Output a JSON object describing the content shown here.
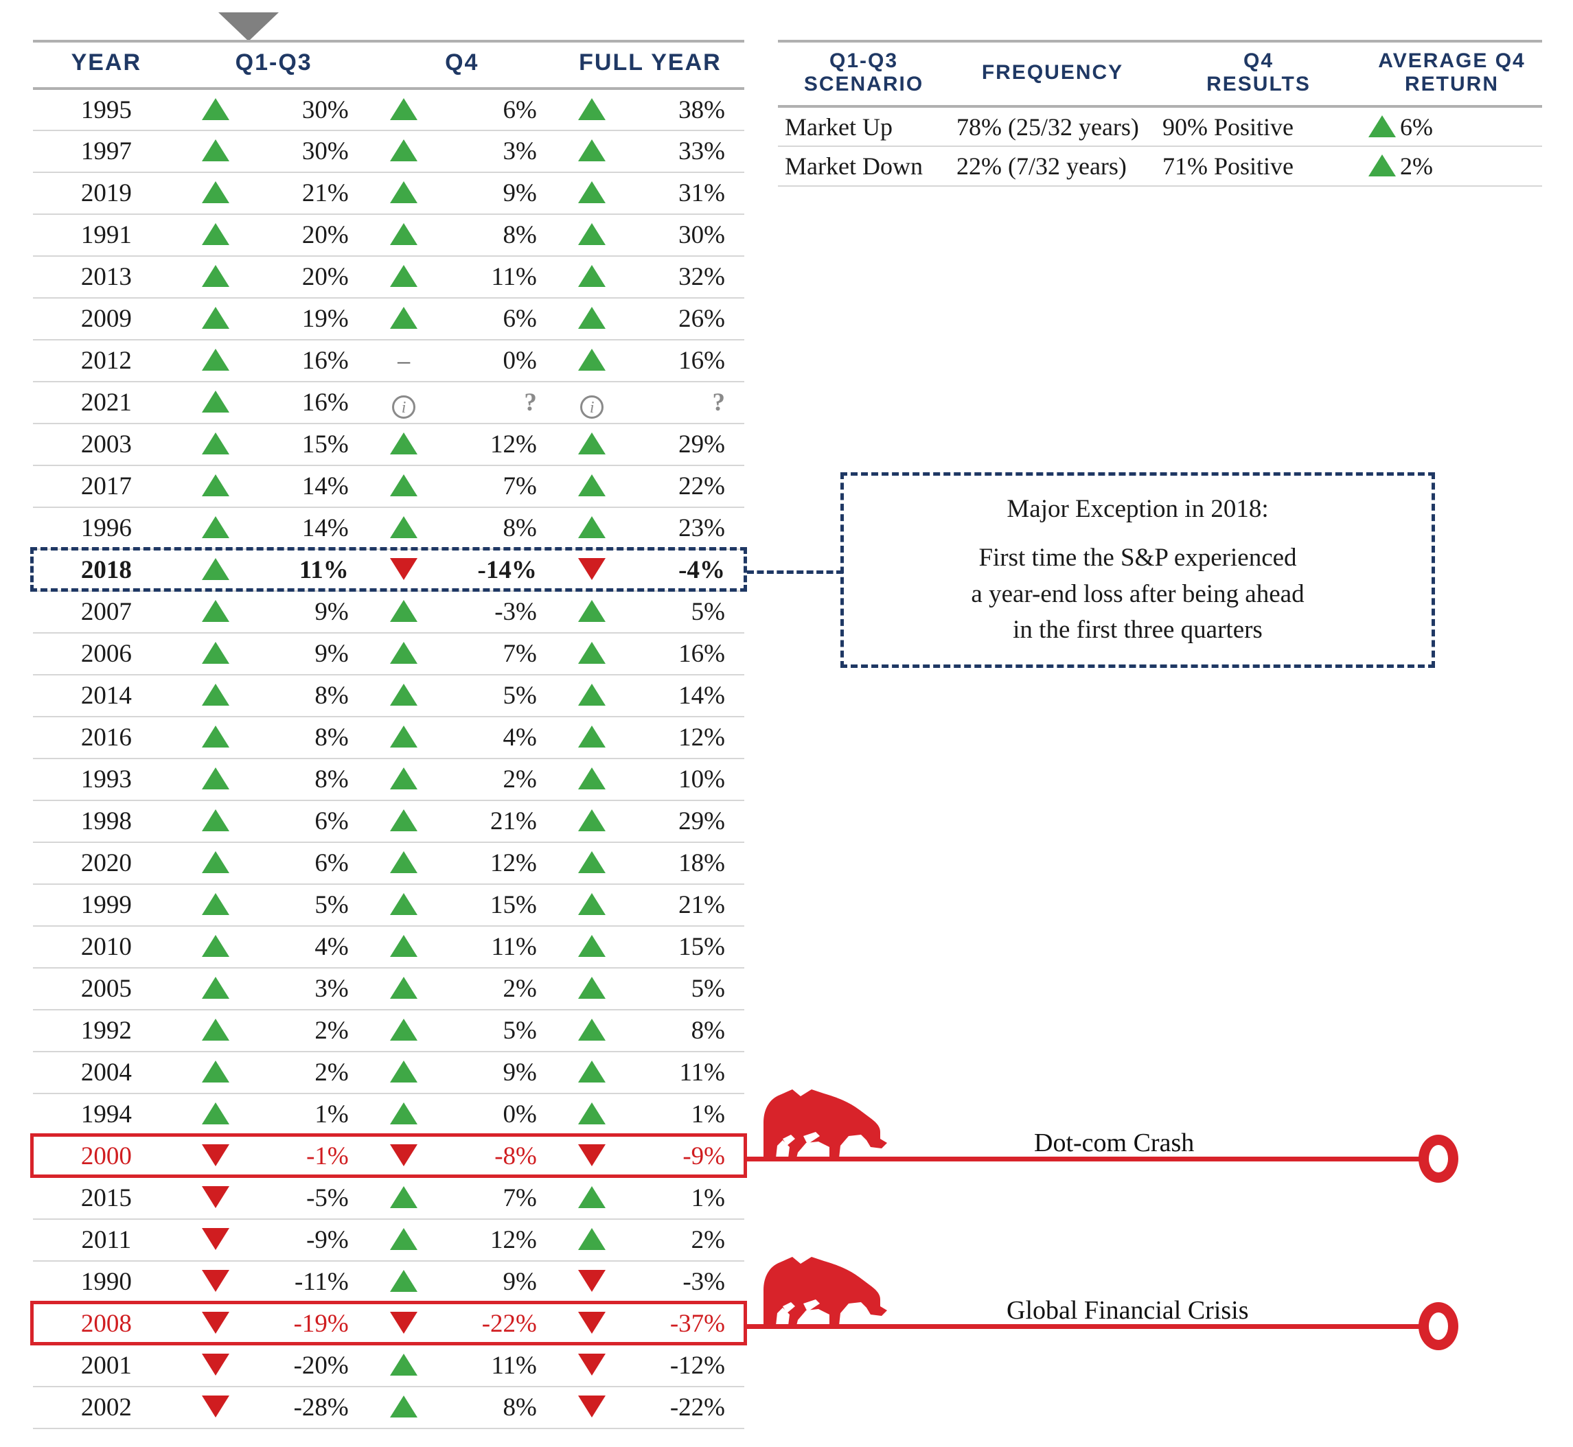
{
  "main_table": {
    "headers": [
      "YEAR",
      "Q1-Q3",
      "Q4",
      "FULL YEAR"
    ],
    "rows": [
      {
        "year": "1995",
        "q13_dir": "up",
        "q13": "30%",
        "q4_dir": "up",
        "q4": "6%",
        "fy_dir": "up",
        "fy": "38%",
        "style": "normal"
      },
      {
        "year": "1997",
        "q13_dir": "up",
        "q13": "30%",
        "q4_dir": "up",
        "q4": "3%",
        "fy_dir": "up",
        "fy": "33%",
        "style": "normal"
      },
      {
        "year": "2019",
        "q13_dir": "up",
        "q13": "21%",
        "q4_dir": "up",
        "q4": "9%",
        "fy_dir": "up",
        "fy": "31%",
        "style": "normal"
      },
      {
        "year": "1991",
        "q13_dir": "up",
        "q13": "20%",
        "q4_dir": "up",
        "q4": "8%",
        "fy_dir": "up",
        "fy": "30%",
        "style": "normal"
      },
      {
        "year": "2013",
        "q13_dir": "up",
        "q13": "20%",
        "q4_dir": "up",
        "q4": "11%",
        "fy_dir": "up",
        "fy": "32%",
        "style": "normal"
      },
      {
        "year": "2009",
        "q13_dir": "up",
        "q13": "19%",
        "q4_dir": "up",
        "q4": "6%",
        "fy_dir": "up",
        "fy": "26%",
        "style": "normal"
      },
      {
        "year": "2012",
        "q13_dir": "up",
        "q13": "16%",
        "q4_dir": "dash",
        "q4": "0%",
        "fy_dir": "up",
        "fy": "16%",
        "style": "normal"
      },
      {
        "year": "2021",
        "q13_dir": "up",
        "q13": "16%",
        "q4_dir": "info",
        "q4": "?",
        "fy_dir": "info",
        "fy": "?",
        "style": "normal"
      },
      {
        "year": "2003",
        "q13_dir": "up",
        "q13": "15%",
        "q4_dir": "up",
        "q4": "12%",
        "fy_dir": "up",
        "fy": "29%",
        "style": "normal"
      },
      {
        "year": "2017",
        "q13_dir": "up",
        "q13": "14%",
        "q4_dir": "up",
        "q4": "7%",
        "fy_dir": "up",
        "fy": "22%",
        "style": "normal"
      },
      {
        "year": "1996",
        "q13_dir": "up",
        "q13": "14%",
        "q4_dir": "up",
        "q4": "8%",
        "fy_dir": "up",
        "fy": "23%",
        "style": "normal"
      },
      {
        "year": "2018",
        "q13_dir": "up",
        "q13": "11%",
        "q4_dir": "down",
        "q4": "-14%",
        "fy_dir": "down",
        "fy": "-4%",
        "style": "bold"
      },
      {
        "year": "2007",
        "q13_dir": "up",
        "q13": "9%",
        "q4_dir": "up",
        "q4": "-3%",
        "fy_dir": "up",
        "fy": "5%",
        "style": "normal"
      },
      {
        "year": "2006",
        "q13_dir": "up",
        "q13": "9%",
        "q4_dir": "up",
        "q4": "7%",
        "fy_dir": "up",
        "fy": "16%",
        "style": "normal"
      },
      {
        "year": "2014",
        "q13_dir": "up",
        "q13": "8%",
        "q4_dir": "up",
        "q4": "5%",
        "fy_dir": "up",
        "fy": "14%",
        "style": "normal"
      },
      {
        "year": "2016",
        "q13_dir": "up",
        "q13": "8%",
        "q4_dir": "up",
        "q4": "4%",
        "fy_dir": "up",
        "fy": "12%",
        "style": "normal"
      },
      {
        "year": "1993",
        "q13_dir": "up",
        "q13": "8%",
        "q4_dir": "up",
        "q4": "2%",
        "fy_dir": "up",
        "fy": "10%",
        "style": "normal"
      },
      {
        "year": "1998",
        "q13_dir": "up",
        "q13": "6%",
        "q4_dir": "up",
        "q4": "21%",
        "fy_dir": "up",
        "fy": "29%",
        "style": "normal"
      },
      {
        "year": "2020",
        "q13_dir": "up",
        "q13": "6%",
        "q4_dir": "up",
        "q4": "12%",
        "fy_dir": "up",
        "fy": "18%",
        "style": "normal"
      },
      {
        "year": "1999",
        "q13_dir": "up",
        "q13": "5%",
        "q4_dir": "up",
        "q4": "15%",
        "fy_dir": "up",
        "fy": "21%",
        "style": "normal"
      },
      {
        "year": "2010",
        "q13_dir": "up",
        "q13": "4%",
        "q4_dir": "up",
        "q4": "11%",
        "fy_dir": "up",
        "fy": "15%",
        "style": "normal"
      },
      {
        "year": "2005",
        "q13_dir": "up",
        "q13": "3%",
        "q4_dir": "up",
        "q4": "2%",
        "fy_dir": "up",
        "fy": "5%",
        "style": "normal"
      },
      {
        "year": "1992",
        "q13_dir": "up",
        "q13": "2%",
        "q4_dir": "up",
        "q4": "5%",
        "fy_dir": "up",
        "fy": "8%",
        "style": "normal"
      },
      {
        "year": "2004",
        "q13_dir": "up",
        "q13": "2%",
        "q4_dir": "up",
        "q4": "9%",
        "fy_dir": "up",
        "fy": "11%",
        "style": "normal"
      },
      {
        "year": "1994",
        "q13_dir": "up",
        "q13": "1%",
        "q4_dir": "up",
        "q4": "0%",
        "fy_dir": "up",
        "fy": "1%",
        "style": "normal"
      },
      {
        "year": "2000",
        "q13_dir": "down",
        "q13": "-1%",
        "q4_dir": "down",
        "q4": "-8%",
        "fy_dir": "down",
        "fy": "-9%",
        "style": "red"
      },
      {
        "year": "2015",
        "q13_dir": "down",
        "q13": "-5%",
        "q4_dir": "up",
        "q4": "7%",
        "fy_dir": "up",
        "fy": "1%",
        "style": "normal"
      },
      {
        "year": "2011",
        "q13_dir": "down",
        "q13": "-9%",
        "q4_dir": "up",
        "q4": "12%",
        "fy_dir": "up",
        "fy": "2%",
        "style": "normal"
      },
      {
        "year": "1990",
        "q13_dir": "down",
        "q13": "-11%",
        "q4_dir": "up",
        "q4": "9%",
        "fy_dir": "down",
        "fy": "-3%",
        "style": "normal"
      },
      {
        "year": "2008",
        "q13_dir": "down",
        "q13": "-19%",
        "q4_dir": "down",
        "q4": "-22%",
        "fy_dir": "down",
        "fy": "-37%",
        "style": "red"
      },
      {
        "year": "2001",
        "q13_dir": "down",
        "q13": "-20%",
        "q4_dir": "up",
        "q4": "11%",
        "fy_dir": "down",
        "fy": "-12%",
        "style": "normal"
      },
      {
        "year": "2002",
        "q13_dir": "down",
        "q13": "-28%",
        "q4_dir": "up",
        "q4": "8%",
        "fy_dir": "down",
        "fy": "-22%",
        "style": "normal"
      }
    ]
  },
  "summary_table": {
    "headers": [
      "Q1-Q3 SCENARIO",
      "FREQUENCY",
      "Q4 RESULTS",
      "AVERAGE Q4 RETURN"
    ],
    "headers_lines": [
      [
        "Q1-Q3",
        "SCENARIO"
      ],
      [
        "FREQUENCY",
        ""
      ],
      [
        "Q4",
        "RESULTS"
      ],
      [
        "AVERAGE Q4",
        "RETURN"
      ]
    ],
    "rows": [
      {
        "scenario": "Market Up",
        "frequency": "78% (25/32 years)",
        "q4_results": "90% Positive",
        "avg_dir": "up",
        "avg_return": "6%"
      },
      {
        "scenario": "Market Down",
        "frequency": "22% (7/32 years)",
        "q4_results": "71% Positive",
        "avg_dir": "up",
        "avg_return": "2%"
      }
    ]
  },
  "callout": {
    "title": "Major Exception in 2018:",
    "line1": "First time the S&P experienced",
    "line2": "a year-end loss after being ahead",
    "line3": "in the first three quarters"
  },
  "annotations": [
    {
      "label": "Dot-com Crash",
      "year": "2000"
    },
    {
      "label": "Global Financial Crisis",
      "year": "2008"
    }
  ],
  "colors": {
    "up_green": "#3fa846",
    "down_red": "#d01d20",
    "header_blue": "#1f3864",
    "highlight_red": "#d8232a",
    "bear_red": "#d8232a"
  }
}
